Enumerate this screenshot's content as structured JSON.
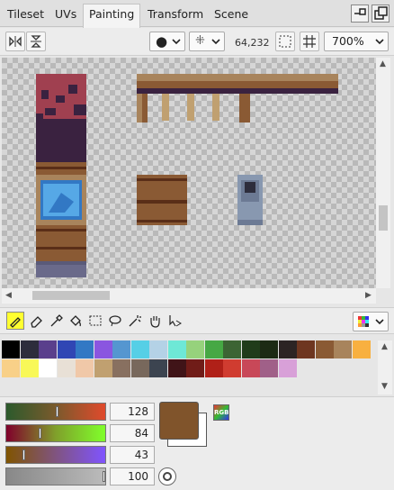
{
  "tabs": [
    "Tileset",
    "UVs",
    "Painting",
    "Transform",
    "Scene"
  ],
  "active_tab": "Painting",
  "toolbar": {
    "brush_shape": "●",
    "grid_mode": "⁜",
    "cursor_coords": "64,232",
    "zoom": "700%"
  },
  "palette": [
    "#000000",
    "#2d2d3c",
    "#5a3f8c",
    "#3046b4",
    "#3278c4",
    "#8a56e0",
    "#5596d0",
    "#56cfe6",
    "#b4d2e6",
    "#6ee8d6",
    "#96d27c",
    "#46a844",
    "#3c6434",
    "#203c1a",
    "#1c2a14",
    "#2c2424",
    "#6e3620",
    "#8a5a34",
    "#a8845c",
    "#f8b040",
    "#f8d088",
    "#f8f858",
    "#ffffff",
    "#e8e0d6",
    "#f0c8a8",
    "#c0a070",
    "#887060",
    "#78685c",
    "#3c4450",
    "#401418",
    "#701c18",
    "#b02018",
    "#d03c30",
    "#c84858",
    "#a06088",
    "#d8a0d8"
  ],
  "editor": {
    "r": 128,
    "g": 84,
    "b": 43,
    "a": 100,
    "current_color": "#80542b",
    "rgb_label": "RGB"
  },
  "icons": [
    "pencil-icon",
    "eraser-icon",
    "eyedropper-icon",
    "bucket-icon",
    "rect-select-icon",
    "lasso-icon",
    "magic-wand-icon",
    "hand-icon",
    "move-icon"
  ]
}
